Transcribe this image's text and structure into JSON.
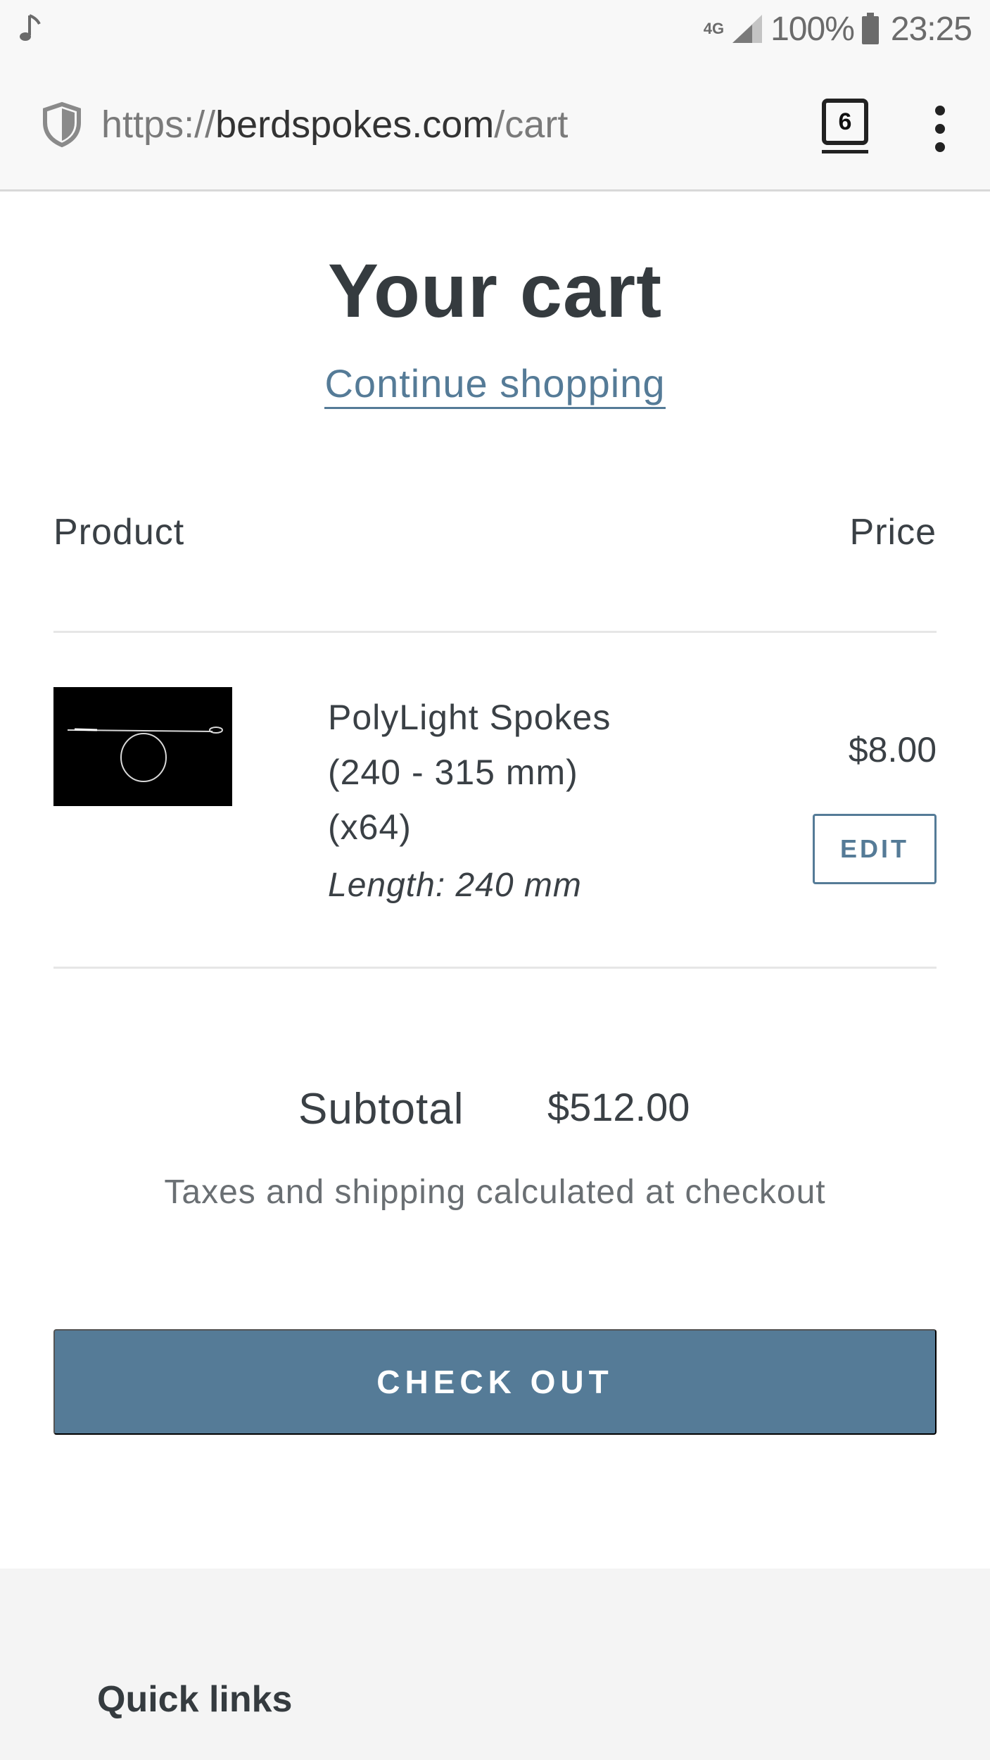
{
  "status_bar": {
    "network": "4G",
    "battery": "100%",
    "time": "23:25",
    "icons": [
      "music-note-icon",
      "signal-icon",
      "battery-icon"
    ]
  },
  "browser": {
    "url_scheme": "https://",
    "url_host": "berdspokes.com",
    "url_path": "/cart",
    "tab_count": "6",
    "icons": [
      "shield-icon",
      "overflow-menu-icon"
    ]
  },
  "cart": {
    "title": "Your cart",
    "continue_link": "Continue shopping",
    "columns": {
      "product": "Product",
      "price": "Price"
    },
    "items": [
      {
        "name": "PolyLight Spokes (240 - 315 mm) (x64)",
        "variant": "Length: 240 mm",
        "price": "$8.00",
        "edit_label": "EDIT"
      }
    ],
    "subtotal_label": "Subtotal",
    "subtotal_value": "$512.00",
    "tax_note": "Taxes and shipping calculated at checkout",
    "checkout_label": "CHECK OUT"
  },
  "footer": {
    "quick_links_heading": "Quick links"
  },
  "colors": {
    "accent": "#557b97",
    "text": "#3a4045",
    "footer_bg": "#f4f4f4"
  }
}
